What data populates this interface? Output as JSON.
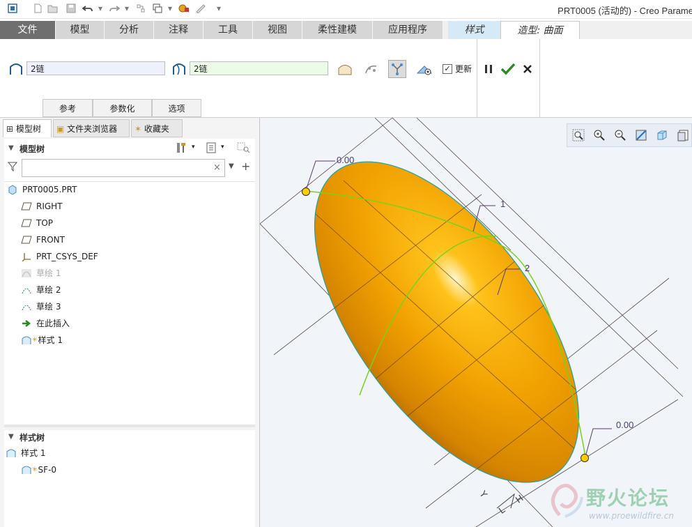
{
  "window": {
    "title": "PRT0005 (活动的) - Creo Parame"
  },
  "quick_access": [
    "window-icon",
    "new-icon",
    "open-icon",
    "save-icon",
    "undo-icon",
    "redo-icon",
    "regenerate-icon",
    "windows-icon",
    "model-display-icon",
    "close-window-icon",
    "customize-icon"
  ],
  "tabs": [
    {
      "label": "文件"
    },
    {
      "label": "模型"
    },
    {
      "label": "分析"
    },
    {
      "label": "注释"
    },
    {
      "label": "工具"
    },
    {
      "label": "视图"
    },
    {
      "label": "柔性建模"
    },
    {
      "label": "应用程序"
    },
    {
      "label": "样式"
    },
    {
      "label": "造型: 曲面"
    }
  ],
  "ribbon": {
    "primary_chain": "2链",
    "cross_chain": "2链",
    "update_label": "更新",
    "update_checked": true,
    "subtabs": [
      "参考",
      "参数化",
      "选项"
    ]
  },
  "panel": {
    "tabs": [
      "模型树",
      "文件夹浏览器",
      "收藏夹"
    ],
    "tree_header": "模型树",
    "filter_placeholder": "",
    "tree_items": [
      {
        "label": "PRT0005.PRT",
        "icon": "part-icon"
      },
      {
        "label": "RIGHT",
        "icon": "datum-plane-icon"
      },
      {
        "label": "TOP",
        "icon": "datum-plane-icon"
      },
      {
        "label": "FRONT",
        "icon": "datum-plane-icon"
      },
      {
        "label": "PRT_CSYS_DEF",
        "icon": "csys-icon"
      },
      {
        "label": "草绘 1",
        "icon": "sketch-icon",
        "dimmed": true
      },
      {
        "label": "草绘 2",
        "icon": "sketch-icon"
      },
      {
        "label": "草绘 3",
        "icon": "sketch-icon"
      },
      {
        "label": "在此插入",
        "icon": "insert-arrow-icon"
      },
      {
        "label": "样式 1",
        "icon": "style-feature-icon",
        "new": true
      }
    ],
    "style_tree_header": "样式树",
    "style_items": [
      {
        "label": "样式 1",
        "icon": "style-feature-icon"
      },
      {
        "label": "SF-0",
        "icon": "surface-icon",
        "new": true
      }
    ]
  },
  "viewport": {
    "tools": [
      "refit-icon",
      "zoom-in-icon",
      "zoom-out-icon",
      "repaint-icon",
      "display-style-icon",
      "view-manager-icon"
    ],
    "annotations": {
      "top_value": "0.00",
      "bottom_value": "0.00",
      "curve1": "1",
      "curve2": "2"
    },
    "csys_labels": [
      "Y",
      "L",
      "H"
    ],
    "watermark": {
      "title": "野火论坛",
      "url": "www.proewildfire.cn"
    },
    "colors": {
      "surface": "#f0a000",
      "edge": "#2aa0a0",
      "curve": "#7ad21a",
      "point": "#ffcc00"
    }
  }
}
